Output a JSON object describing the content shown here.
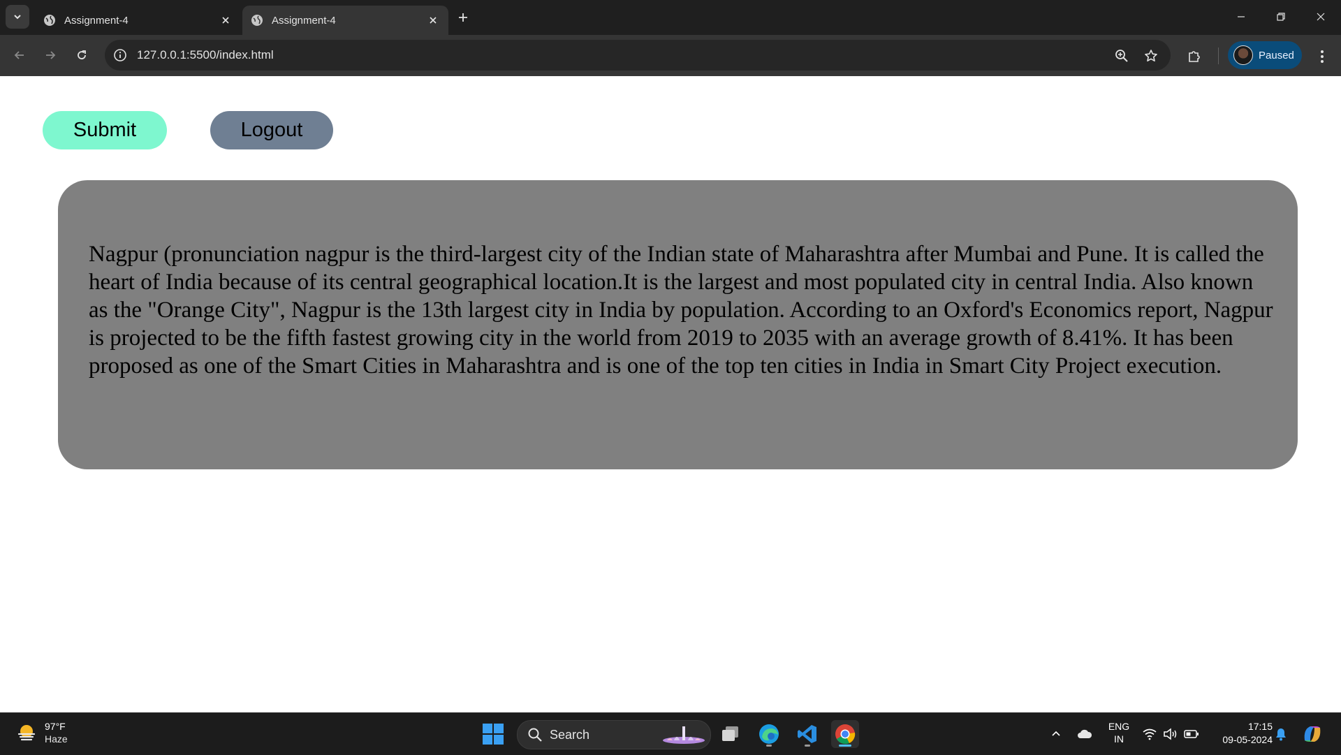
{
  "browser": {
    "tabs": [
      {
        "title": "Assignment-4",
        "active": false
      },
      {
        "title": "Assignment-4",
        "active": true
      }
    ],
    "url": "127.0.0.1:5500/index.html",
    "profile_status": "Paused"
  },
  "page": {
    "submit_label": "Submit",
    "logout_label": "Logout",
    "paragraph": "Nagpur (pronunciation nagpur is the third-largest city of the Indian state of Maharashtra after Mumbai and Pune. It is called the heart of India because of its central geographical location.It is the largest and most populated city in central India. Also known as the \"Orange City\", Nagpur is the 13th largest city in India by population. According to an Oxford's Economics report, Nagpur is projected to be the fifth fastest growing city in the world from 2019 to 2035 with an average growth of 8.41%. It has been proposed as one of the Smart Cities in Maharashtra and is one of the top ten cities in India in Smart City Project execution.",
    "colors": {
      "submit_bg": "#7ef7cf",
      "logout_bg": "#6f7f93",
      "content_bg": "#808080"
    }
  },
  "taskbar": {
    "weather": {
      "temp": "97°F",
      "condition": "Haze"
    },
    "search_label": "Search",
    "lang_line1": "ENG",
    "lang_line2": "IN",
    "time": "17:15",
    "date": "09-05-2024",
    "apps": [
      "task-view-icon",
      "edge-icon",
      "vscode-icon",
      "chrome-icon"
    ]
  }
}
